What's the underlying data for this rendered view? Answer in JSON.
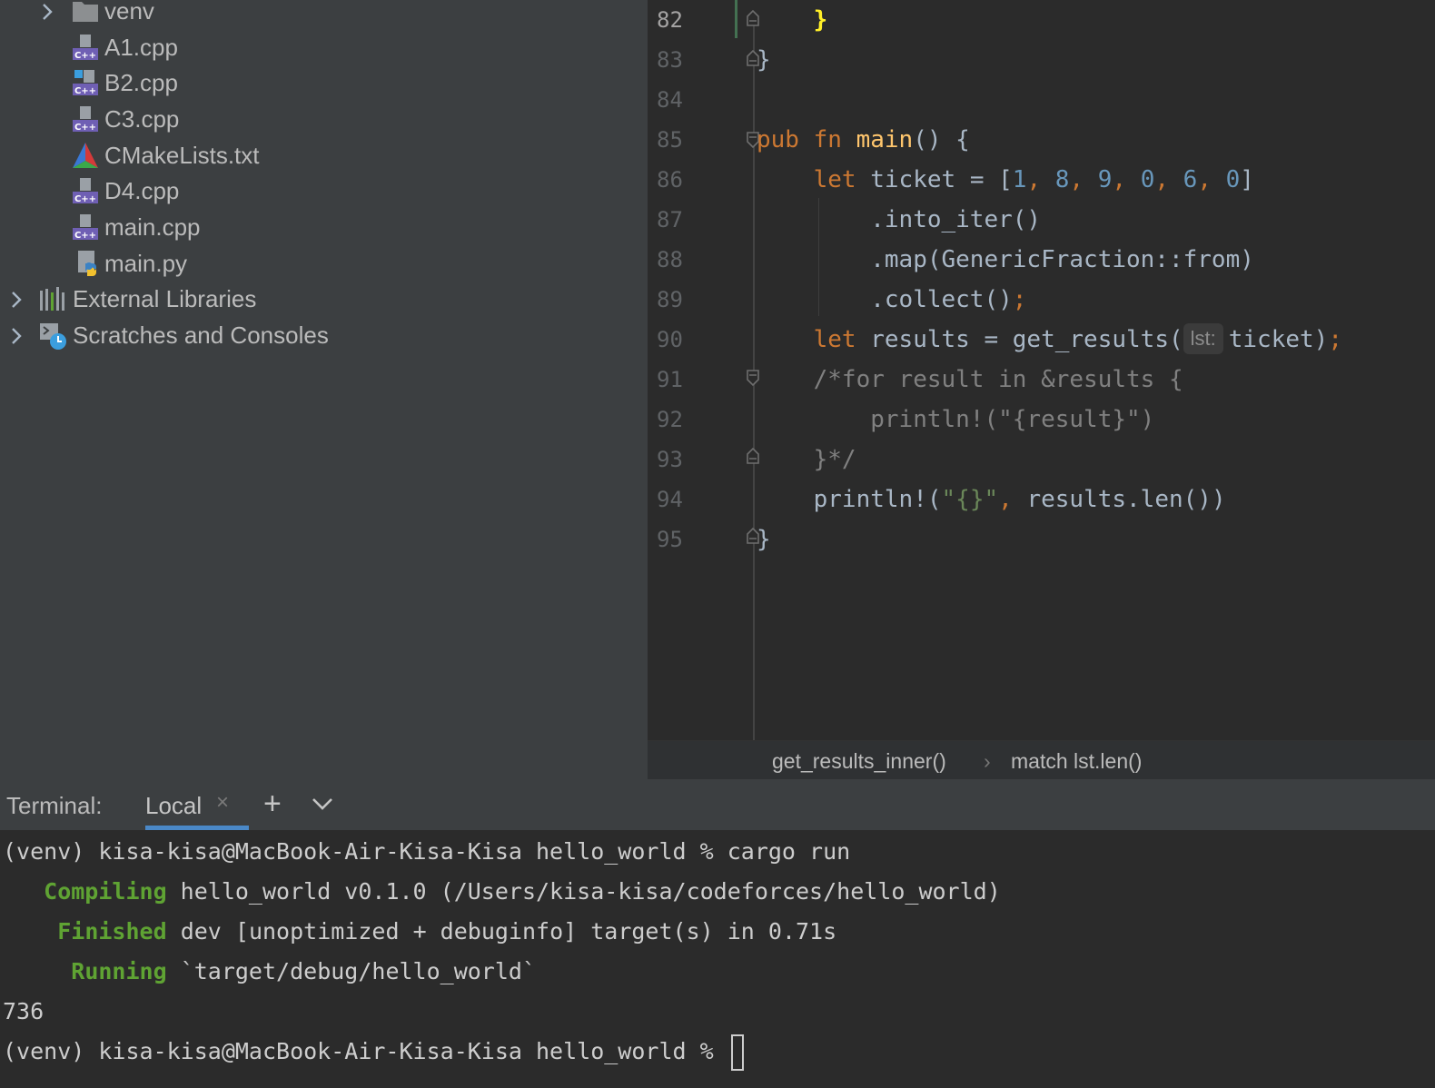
{
  "project_tree": {
    "items": [
      {
        "label": "venv",
        "icon": "folder-icon",
        "expandable": true
      },
      {
        "label": "A1.cpp",
        "icon": "cpp-file-icon"
      },
      {
        "label": "B2.cpp",
        "icon": "cpp-file-icon"
      },
      {
        "label": "C3.cpp",
        "icon": "cpp-file-icon"
      },
      {
        "label": "CMakeLists.txt",
        "icon": "cmake-icon"
      },
      {
        "label": "D4.cpp",
        "icon": "cpp-file-icon"
      },
      {
        "label": "main.cpp",
        "icon": "cpp-file-icon"
      },
      {
        "label": "main.py",
        "icon": "python-file-icon"
      },
      {
        "label": "External Libraries",
        "icon": "libraries-icon",
        "expandable": true
      },
      {
        "label": "Scratches and Consoles",
        "icon": "scratches-icon",
        "expandable": true
      }
    ]
  },
  "editor": {
    "line_numbers": [
      "82",
      "83",
      "84",
      "85",
      "86",
      "87",
      "88",
      "89",
      "90",
      "91",
      "92",
      "93",
      "94",
      "95"
    ],
    "code": {
      "l82": "}",
      "l83": "}",
      "l85_kw1": "pub",
      "l85_kw2": "fn",
      "l85_name": "main",
      "l85_rest": "() {",
      "l86_kw": "let",
      "l86_a": " ticket = [",
      "l86_nums": [
        "1",
        "8",
        "9",
        "0",
        "6",
        "0"
      ],
      "l86_sep": ", ",
      "l86_end": "]",
      "l87": ".into_iter()",
      "l88": ".map(GenericFraction::from)",
      "l89_a": ".collect()",
      "l89_semi": ";",
      "l90_kw": "let",
      "l90_a": " results = get_results(",
      "l90_hint": "lst:",
      "l90_b": "ticket)",
      "l90_semi": ";",
      "l91": "/*for result in &results {",
      "l92": "println!(\"{result}\")",
      "l93": "}*/",
      "l94_a": "println!(",
      "l94_str": "\"{}\"",
      "l94_comma": ",",
      "l94_b": " results.len())",
      "l95": "}"
    }
  },
  "breadcrumb": {
    "items": [
      "get_results_inner()",
      "match lst.len()"
    ],
    "separator": "›"
  },
  "terminal": {
    "title": "Terminal:",
    "tab_label": "Local",
    "close_glyph": "×",
    "add_glyph": "+",
    "lines": {
      "cmd": "(venv) kisa-kisa@MacBook-Air-Kisa-Kisa hello_world % cargo run",
      "compiling_kw": "Compiling",
      "compiling_rest": " hello_world v0.1.0 (/Users/kisa-kisa/codeforces/hello_world)",
      "finished_kw": "Finished",
      "finished_rest": " dev [unoptimized + debuginfo] target(s) in 0.71s",
      "running_kw": "Running",
      "running_rest": " `target/debug/hello_world`",
      "output": "736",
      "prompt": "(venv) kisa-kisa@MacBook-Air-Kisa-Kisa hello_world %"
    }
  },
  "colors": {
    "keyword": "#cc7832",
    "function": "#ffc66d",
    "number": "#6897bb",
    "string": "#6a8759",
    "comment": "#808080",
    "terminal_green": "#5fa333",
    "tab_underline": "#4a88c7"
  }
}
